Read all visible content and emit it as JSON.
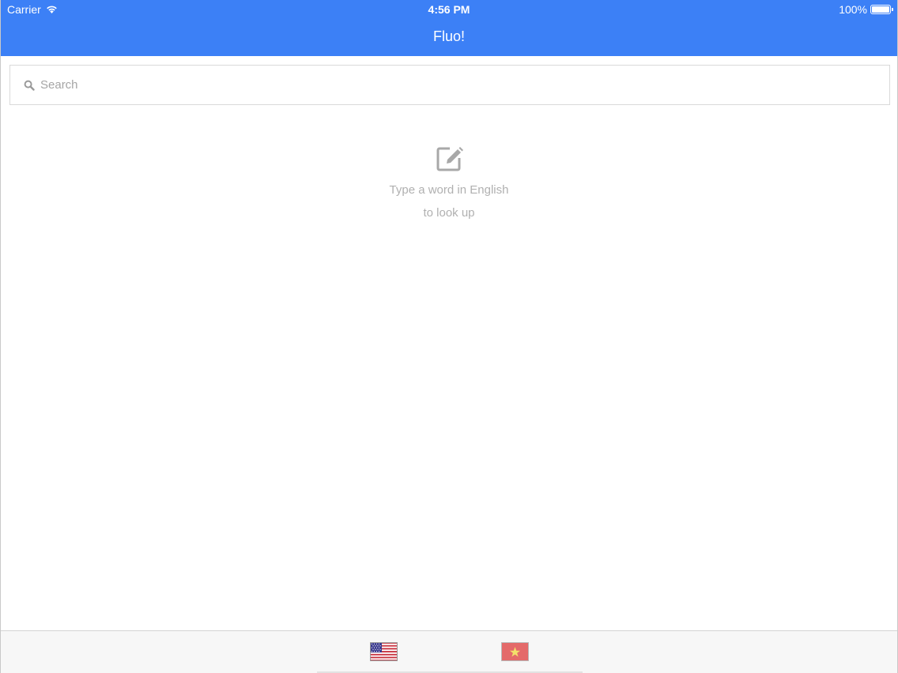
{
  "status_bar": {
    "carrier": "Carrier",
    "time": "4:56 PM",
    "battery": "100%",
    "battery_level": 1.0
  },
  "nav": {
    "title": "Fluo!"
  },
  "search": {
    "placeholder": "Search",
    "value": "",
    "icon": "search-icon"
  },
  "empty_state": {
    "icon": "edit-icon",
    "line1": "Type a word in English",
    "line2": "to look up"
  },
  "tabs": [
    {
      "icon": "us-flag-icon",
      "language": "English"
    },
    {
      "icon": "vietnam-flag-icon",
      "language": "Vietnamese"
    }
  ],
  "colors": {
    "accent": "#3c80f6",
    "muted_text": "#b0b0b0",
    "vietnam_red": "#da251d",
    "vietnam_star": "#ffff00"
  }
}
